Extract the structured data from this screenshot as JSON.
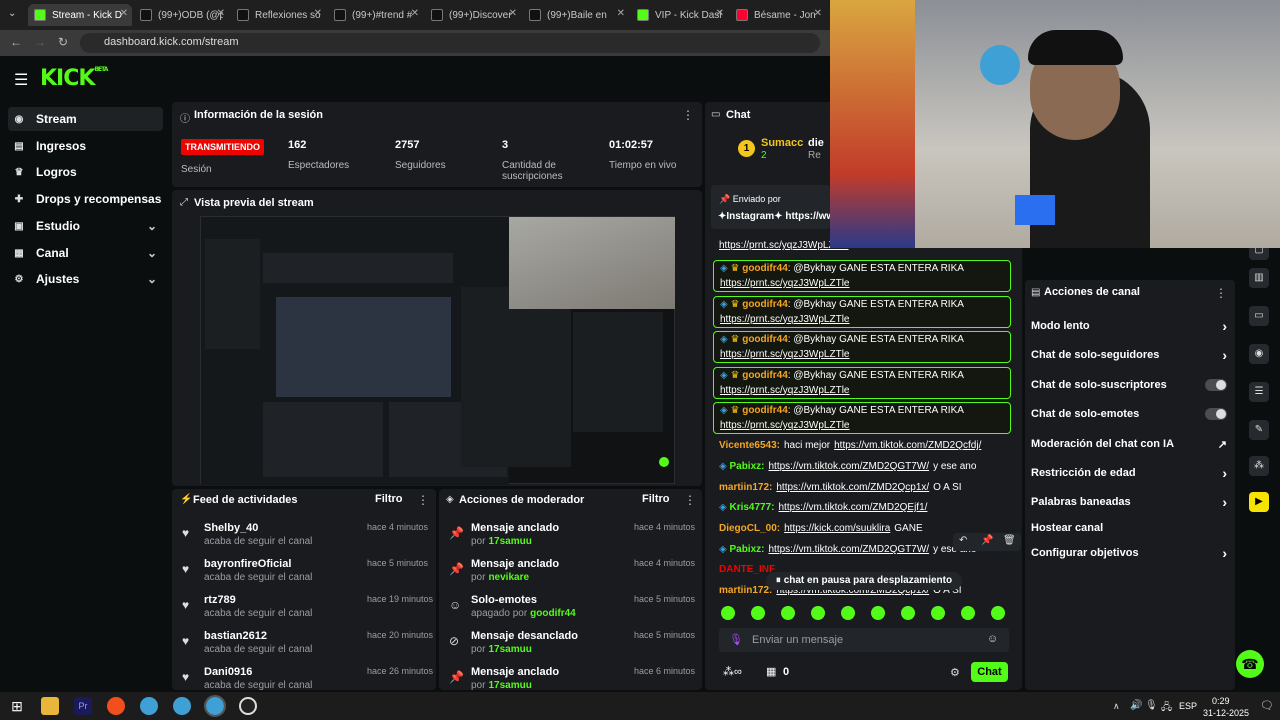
{
  "browser": {
    "tabs": [
      {
        "label": "Stream - Kick D",
        "active": true,
        "icon": "kick-icon"
      },
      {
        "label": "(99+)ODB (@p",
        "icon": "tiktok-icon"
      },
      {
        "label": "Reflexiones sol",
        "icon": "tiktok-icon"
      },
      {
        "label": "(99+)#trend #",
        "icon": "tiktok-icon"
      },
      {
        "label": "(99+)Discover",
        "icon": "tiktok-icon"
      },
      {
        "label": "(99+)Baile en",
        "icon": "tiktok-icon"
      },
      {
        "label": "VIP - Kick Dash",
        "icon": "kick-icon"
      },
      {
        "label": "Bésame - Jon",
        "icon": "youtube-icon"
      }
    ],
    "url": "dashboard.kick.com/stream"
  },
  "brand": {
    "logo": "KICK",
    "logo_tag": "BETA",
    "accent": "#53fc18"
  },
  "sidebar": {
    "items": [
      {
        "label": "Stream",
        "icon": "stream-icon",
        "active": true
      },
      {
        "label": "Ingresos",
        "icon": "income-icon"
      },
      {
        "label": "Logros",
        "icon": "trophy-icon"
      },
      {
        "label": "Drops y recompensas",
        "icon": "gift-icon"
      },
      {
        "label": "Estudio",
        "icon": "studio-icon",
        "chevron": true
      },
      {
        "label": "Canal",
        "icon": "channel-icon",
        "chevron": true
      },
      {
        "label": "Ajustes",
        "icon": "gear-icon",
        "chevron": true
      }
    ]
  },
  "session": {
    "title": "Información de la sesión",
    "badge": "TRANSMITIENDO",
    "session_label": "Sesión",
    "stats": [
      {
        "value": "162",
        "label": "Espectadores"
      },
      {
        "value": "2757",
        "label": "Seguidores"
      },
      {
        "value": "3",
        "label": "Cantidad de suscripciones"
      },
      {
        "value": "01:02:57",
        "label": "Tiempo en vivo"
      }
    ]
  },
  "preview": {
    "title": "Vista previa del stream"
  },
  "feed": {
    "title": "Feed de actividades",
    "filter": "Filtro",
    "items": [
      {
        "name": "Shelby_40",
        "sub": "acaba de seguir el canal",
        "time": "hace 4 minutos"
      },
      {
        "name": "bayronfireOficial",
        "sub": "acaba de seguir el canal",
        "time": "hace 5 minutos"
      },
      {
        "name": "rtz789",
        "sub": "acaba de seguir el canal",
        "time": "hace 19 minutos"
      },
      {
        "name": "bastian2612",
        "sub": "acaba de seguir el canal",
        "time": "hace 20 minutos"
      },
      {
        "name": "Dani0916",
        "sub": "acaba de seguir el canal",
        "time": "hace 26 minutos"
      }
    ]
  },
  "modactions": {
    "title": "Acciones de moderador",
    "filter": "Filtro",
    "items": [
      {
        "action": "Mensaje anclado",
        "prefix": "por",
        "user": "17samuu",
        "time": "hace 4 minutos",
        "icon": "pin-icon"
      },
      {
        "action": "Mensaje anclado",
        "prefix": "por",
        "user": "nevikare",
        "time": "hace 4 minutos",
        "icon": "pin-icon"
      },
      {
        "action": "Solo-emotes",
        "prefix": "apagado por",
        "user": "goodifr44",
        "time": "hace 5 minutos",
        "icon": "emote-icon"
      },
      {
        "action": "Mensaje desanclado",
        "prefix": "por",
        "user": "17samuu",
        "time": "hace 5 minutos",
        "icon": "unpin-icon"
      },
      {
        "action": "Mensaje anclado",
        "prefix": "por",
        "user": "17samuu",
        "time": "hace 6 minutos",
        "icon": "pin-icon"
      }
    ]
  },
  "chat": {
    "title": "Chat",
    "top_users": [
      "Sumacc",
      "die"
    ],
    "top_rank": "2",
    "top_sub": "Re",
    "pinned_sender": "Enviado por",
    "pinned_text": "✦Instagram✦ https://ww",
    "partial_link": "https://prnt.sc/yqzJ3WpLZTle",
    "pinned_messages": [
      {
        "user": "goodifr44",
        "text": "@Bykhay GANE ESTA ENTERA RIKA",
        "link": "https://prnt.sc/yqzJ3WpLZTle"
      },
      {
        "user": "goodifr44",
        "text": "@Bykhay GANE ESTA ENTERA RIKA",
        "link": "https://prnt.sc/yqzJ3WpLZTle"
      },
      {
        "user": "goodifr44",
        "text": "@Bykhay GANE ESTA ENTERA RIKA",
        "link": "https://prnt.sc/yqzJ3WpLZTle"
      },
      {
        "user": "goodifr44",
        "text": "@Bykhay GANE ESTA ENTERA RIKA",
        "link": "https://prnt.sc/yqzJ3WpLZTle"
      },
      {
        "user": "goodifr44",
        "text": "@Bykhay GANE ESTA ENTERA RIKA",
        "link": "https://prnt.sc/yqzJ3WpLZTle"
      }
    ],
    "messages": [
      {
        "user": "Vicente6543:",
        "color": "#f5a623",
        "text": "haci mejor",
        "link": "https://vm.tiktok.com/ZMD2Qcfdj/",
        "after": ""
      },
      {
        "user": "Pabixz:",
        "color": "#53fc18",
        "text": "",
        "link": "https://vm.tiktok.com/ZMD2QGT7W/",
        "after": "y ese ano"
      },
      {
        "user": "martiin172:",
        "color": "#f5a623",
        "text": "",
        "link": "https://vm.tiktok.com/ZMD2Qcp1x/",
        "after": "O A SI"
      },
      {
        "user": "Kris4777:",
        "color": "#53fc18",
        "text": "",
        "link": "https://vm.tiktok.com/ZMD2QEjf1/",
        "after": ""
      },
      {
        "user": "DiegoCL_00:",
        "color": "#f5a623",
        "text": "",
        "link": "https://kick.com/suuklira",
        "after": "GANE"
      },
      {
        "user": "Pabixz:",
        "color": "#53fc18",
        "text": "",
        "link": "https://vm.tiktok.com/ZMD2QGT7W/",
        "after": "y ese ano"
      },
      {
        "user": "DANTE_INF",
        "color": "#eb0400",
        "text": "",
        "link": "",
        "after": ""
      },
      {
        "user": "martiin172:",
        "color": "#f5a623",
        "text": "",
        "link": "https://vm.tiktok.com/ZMD2Qcp1x/",
        "after": "O A SI"
      }
    ],
    "paused": "chat en pausa para desplazamiento",
    "placeholder": "Enviar un mensaje",
    "points": "0",
    "send": "Chat"
  },
  "channel_actions": {
    "title": "Acciones de canal",
    "items": [
      {
        "label": "Modo lento",
        "kind": "chevron"
      },
      {
        "label": "Chat de solo-seguidores",
        "kind": "chevron"
      },
      {
        "label": "Chat de solo-suscriptores",
        "kind": "toggle"
      },
      {
        "label": "Chat de solo-emotes",
        "kind": "toggle"
      },
      {
        "label": "Moderación del chat con IA",
        "kind": "external"
      },
      {
        "label": "Restricción de edad",
        "kind": "chevron"
      },
      {
        "label": "Palabras baneadas",
        "kind": "chevron"
      },
      {
        "label": "Hostear canal",
        "kind": "none"
      },
      {
        "label": "Configurar objetivos",
        "kind": "chevron"
      }
    ]
  },
  "taskbar": {
    "lang": "ESP",
    "time": "0:29",
    "date": "31-12-2025"
  }
}
